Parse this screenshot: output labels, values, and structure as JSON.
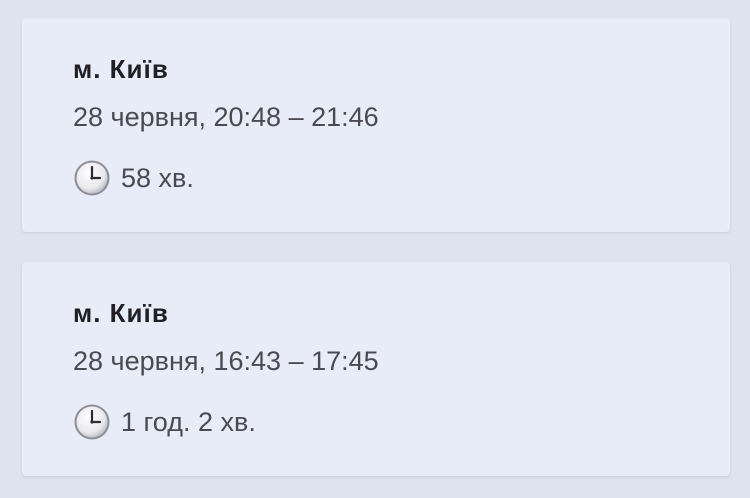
{
  "outages": [
    {
      "city": "м. Київ",
      "time_range": "28 червня, 20:48 – 21:46",
      "duration_icon": "clock-icon",
      "duration": "58 хв."
    },
    {
      "city": "м. Київ",
      "time_range": "28 червня, 16:43 – 17:45",
      "duration_icon": "clock-icon",
      "duration": "1 год. 2 хв."
    }
  ],
  "colors": {
    "page_background": "#dfe3ef",
    "card_background": "#e8ebf8",
    "title_text": "#1f1f24",
    "secondary_text": "#4a4a52"
  }
}
